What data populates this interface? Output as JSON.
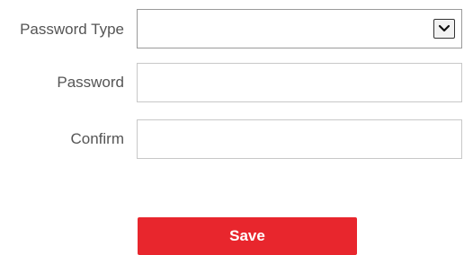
{
  "form": {
    "password_type": {
      "label": "Password Type",
      "value": ""
    },
    "password": {
      "label": "Password",
      "value": "",
      "placeholder": ""
    },
    "confirm": {
      "label": "Confirm",
      "value": "",
      "placeholder": ""
    },
    "save_label": "Save"
  },
  "colors": {
    "save_button": "#e8262d",
    "label_text": "#555555",
    "field_border": "#c8c8c8"
  },
  "icons": {
    "dropdown": "chevron-down-icon"
  }
}
